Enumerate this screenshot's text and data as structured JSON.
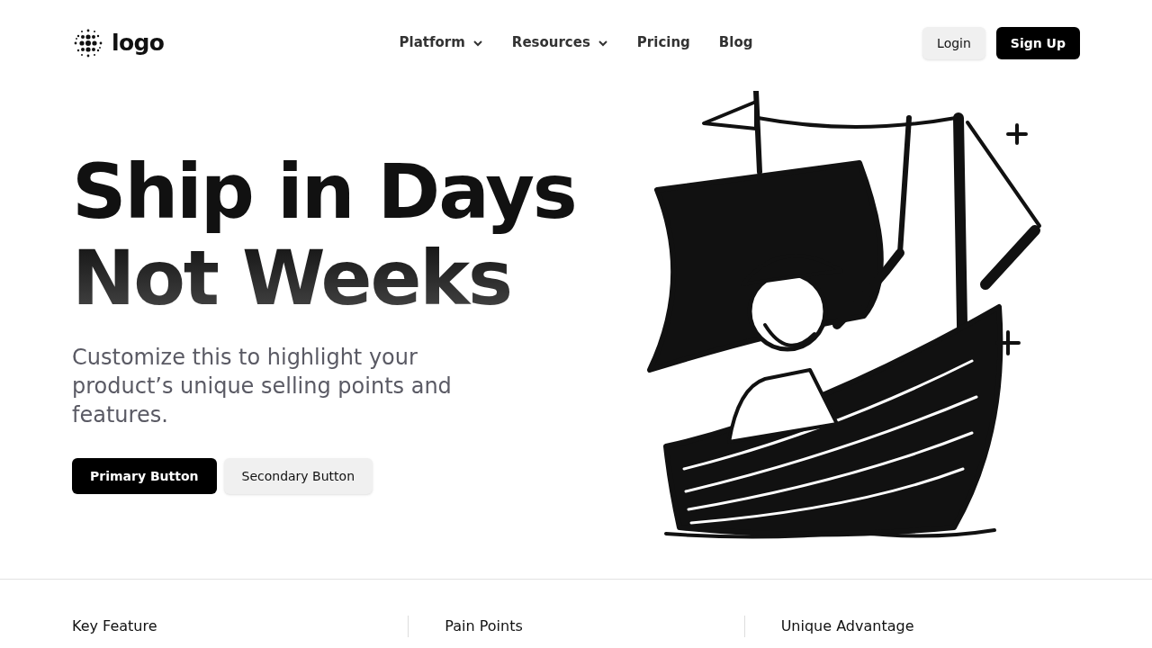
{
  "header": {
    "logo": "logo",
    "nav": [
      {
        "label": "Platform",
        "dropdown": true
      },
      {
        "label": "Resources",
        "dropdown": true
      },
      {
        "label": "Pricing",
        "dropdown": false
      },
      {
        "label": "Blog",
        "dropdown": false
      }
    ],
    "login": "Login",
    "signup": "Sign Up"
  },
  "hero": {
    "title_line_1": "Ship in Days",
    "title_line_2": "Not Weeks",
    "subtitle": "Customize this to highlight your product’s unique selling points and features.",
    "primary_button": "Primary Button",
    "secondary_button": "Secondary Button"
  },
  "features": [
    {
      "title": "Key Feature"
    },
    {
      "title": "Pain Points"
    },
    {
      "title": "Unique Advantage"
    }
  ]
}
